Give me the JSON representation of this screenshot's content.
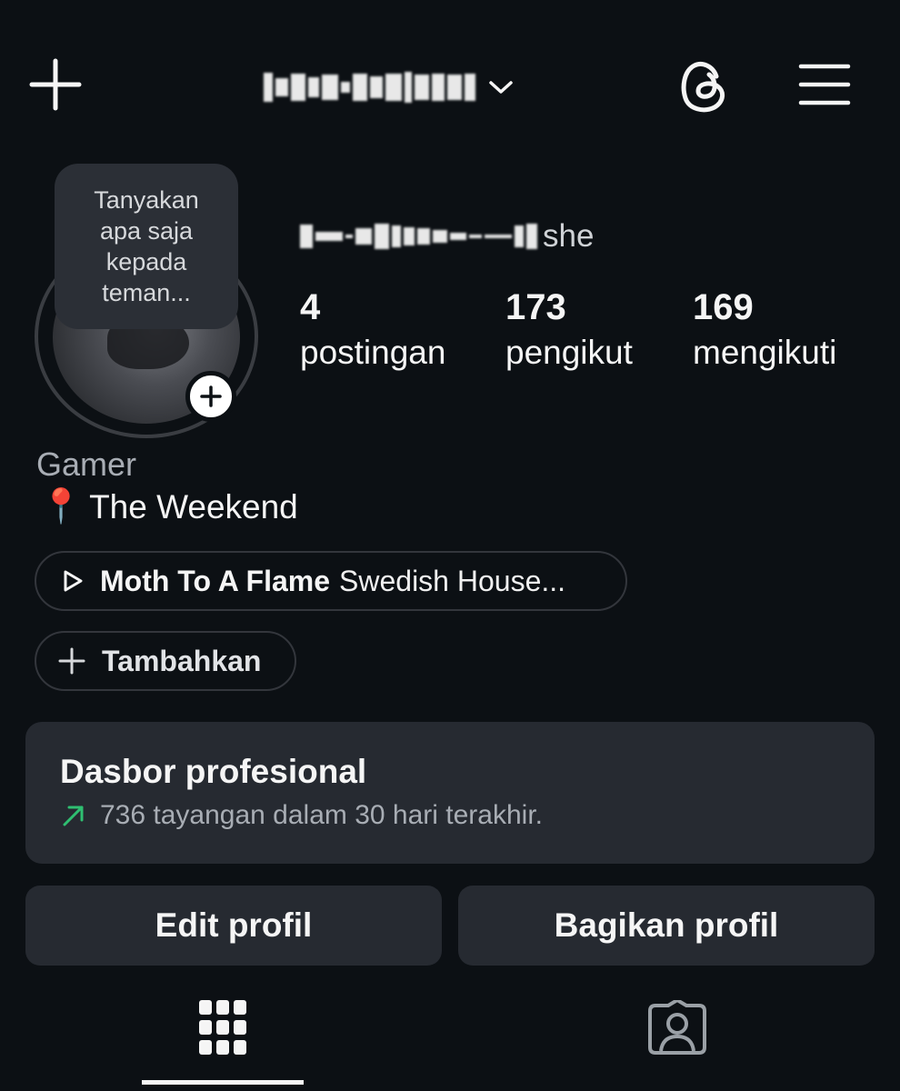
{
  "header": {
    "create_icon": "plus-icon",
    "username": "",
    "username_dropdown_icon": "chevron-down-icon",
    "threads_icon": "threads-icon",
    "menu_icon": "hamburger-menu-icon"
  },
  "profile": {
    "note_text": "Tanyakan apa saja kepada teman...",
    "display_name": "",
    "pronoun": "she",
    "stats": [
      {
        "count": "4",
        "label": "postingan"
      },
      {
        "count": "173",
        "label": "pengikut"
      },
      {
        "count": "169",
        "label": "mengikuti"
      }
    ],
    "category": "Gamer",
    "location_emoji": "📍",
    "location": "The Weekend",
    "music": {
      "icon": "play-icon",
      "title": "Moth To A Flame",
      "artist": "Swedish House..."
    },
    "add_label": "Tambahkan"
  },
  "dashboard": {
    "title": "Dasbor profesional",
    "subtitle": "736 tayangan dalam 30 hari terakhir.",
    "trend_icon": "trend-up-arrow-icon",
    "trend_color": "#2fbf71"
  },
  "actions": {
    "edit": "Edit profil",
    "share": "Bagikan profil"
  },
  "tabs": [
    {
      "name": "grid",
      "icon": "grid-icon",
      "active": true
    },
    {
      "name": "tagged",
      "icon": "tagged-person-icon",
      "active": false
    }
  ]
}
